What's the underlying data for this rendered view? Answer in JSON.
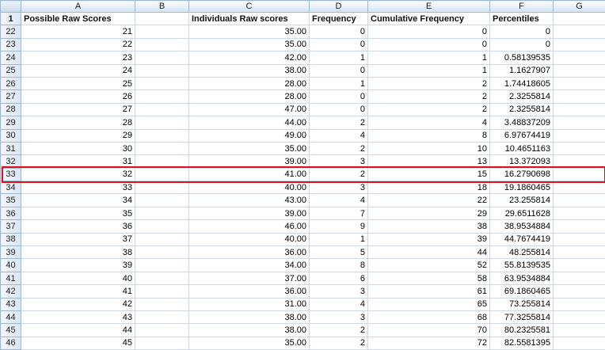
{
  "columns": [
    "A",
    "B",
    "C",
    "D",
    "E",
    "F",
    "G"
  ],
  "header_row": {
    "row_number": "1",
    "cells": [
      "Possible Raw Scores",
      "",
      "Individuals Raw scores",
      "Frequency",
      "Cumulative Frequency",
      "Percentiles",
      ""
    ]
  },
  "rows": [
    {
      "n": "22",
      "a": "21",
      "b": "",
      "c": "35.00",
      "d": "0",
      "e": "0",
      "f": "0",
      "g": ""
    },
    {
      "n": "23",
      "a": "22",
      "b": "",
      "c": "35.00",
      "d": "0",
      "e": "0",
      "f": "0",
      "g": ""
    },
    {
      "n": "24",
      "a": "23",
      "b": "",
      "c": "42.00",
      "d": "1",
      "e": "1",
      "f": "0.58139535",
      "g": ""
    },
    {
      "n": "25",
      "a": "24",
      "b": "",
      "c": "38.00",
      "d": "0",
      "e": "1",
      "f": "1.1627907",
      "g": ""
    },
    {
      "n": "26",
      "a": "25",
      "b": "",
      "c": "28.00",
      "d": "1",
      "e": "2",
      "f": "1.74418605",
      "g": ""
    },
    {
      "n": "27",
      "a": "26",
      "b": "",
      "c": "28.00",
      "d": "0",
      "e": "2",
      "f": "2.3255814",
      "g": ""
    },
    {
      "n": "28",
      "a": "27",
      "b": "",
      "c": "47.00",
      "d": "0",
      "e": "2",
      "f": "2.3255814",
      "g": ""
    },
    {
      "n": "29",
      "a": "28",
      "b": "",
      "c": "44.00",
      "d": "2",
      "e": "4",
      "f": "3.48837209",
      "g": ""
    },
    {
      "n": "30",
      "a": "29",
      "b": "",
      "c": "49.00",
      "d": "4",
      "e": "8",
      "f": "6.97674419",
      "g": ""
    },
    {
      "n": "31",
      "a": "30",
      "b": "",
      "c": "35.00",
      "d": "2",
      "e": "10",
      "f": "10.4651163",
      "g": ""
    },
    {
      "n": "32",
      "a": "31",
      "b": "",
      "c": "39.00",
      "d": "3",
      "e": "13",
      "f": "13.372093",
      "g": ""
    },
    {
      "n": "33",
      "a": "32",
      "b": "",
      "c": "41.00",
      "d": "2",
      "e": "15",
      "f": "16.2790698",
      "g": ""
    },
    {
      "n": "34",
      "a": "33",
      "b": "",
      "c": "40.00",
      "d": "3",
      "e": "18",
      "f": "19.1860465",
      "g": ""
    },
    {
      "n": "35",
      "a": "34",
      "b": "",
      "c": "43.00",
      "d": "4",
      "e": "22",
      "f": "23.255814",
      "g": ""
    },
    {
      "n": "36",
      "a": "35",
      "b": "",
      "c": "39.00",
      "d": "7",
      "e": "29",
      "f": "29.6511628",
      "g": ""
    },
    {
      "n": "37",
      "a": "36",
      "b": "",
      "c": "46.00",
      "d": "9",
      "e": "38",
      "f": "38.9534884",
      "g": ""
    },
    {
      "n": "38",
      "a": "37",
      "b": "",
      "c": "40.00",
      "d": "1",
      "e": "39",
      "f": "44.7674419",
      "g": ""
    },
    {
      "n": "39",
      "a": "38",
      "b": "",
      "c": "36.00",
      "d": "5",
      "e": "44",
      "f": "48.255814",
      "g": ""
    },
    {
      "n": "40",
      "a": "39",
      "b": "",
      "c": "34.00",
      "d": "8",
      "e": "52",
      "f": "55.8139535",
      "g": ""
    },
    {
      "n": "41",
      "a": "40",
      "b": "",
      "c": "37.00",
      "d": "6",
      "e": "58",
      "f": "63.9534884",
      "g": ""
    },
    {
      "n": "42",
      "a": "41",
      "b": "",
      "c": "36.00",
      "d": "3",
      "e": "61",
      "f": "69.1860465",
      "g": ""
    },
    {
      "n": "43",
      "a": "42",
      "b": "",
      "c": "31.00",
      "d": "4",
      "e": "65",
      "f": "73.255814",
      "g": ""
    },
    {
      "n": "44",
      "a": "43",
      "b": "",
      "c": "38.00",
      "d": "3",
      "e": "68",
      "f": "77.3255814",
      "g": ""
    },
    {
      "n": "45",
      "a": "44",
      "b": "",
      "c": "38.00",
      "d": "2",
      "e": "70",
      "f": "80.2325581",
      "g": ""
    },
    {
      "n": "46",
      "a": "45",
      "b": "",
      "c": "35.00",
      "d": "2",
      "e": "72",
      "f": "82.5581395",
      "g": ""
    }
  ],
  "highlight_row": "33",
  "highlight_color": "#e0101a"
}
